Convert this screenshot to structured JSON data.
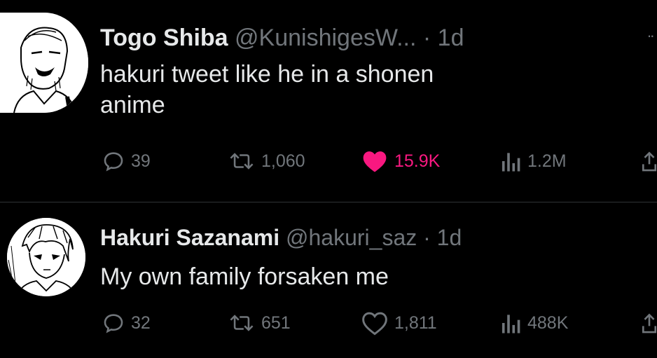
{
  "tweets": [
    {
      "display_name": "Togo Shiba",
      "handle": "@KunishigesW...",
      "separator": "·",
      "time": "1d",
      "text": "hakuri tweet like he in a shonen\nanime",
      "replies": "39",
      "retweets": "1,060",
      "likes": "15.9K",
      "liked": true,
      "views": "1.2M",
      "avatar_icon": "manga-man-avatar-icon"
    },
    {
      "display_name": "Hakuri Sazanami",
      "handle": "@hakuri_saz",
      "separator": "·",
      "time": "1d",
      "text": "My own family forsaken me",
      "replies": "32",
      "retweets": "651",
      "likes": "1,811",
      "liked": false,
      "views": "488K",
      "avatar_icon": "manga-boy-avatar-icon"
    }
  ],
  "colors": {
    "background": "#000000",
    "text": "#e7e9ea",
    "muted": "#71767b",
    "like_active": "#f91880",
    "divider": "#2f3336"
  },
  "icons": [
    "reply-icon",
    "retweet-icon",
    "like-icon",
    "views-icon",
    "share-icon",
    "more-icon"
  ]
}
